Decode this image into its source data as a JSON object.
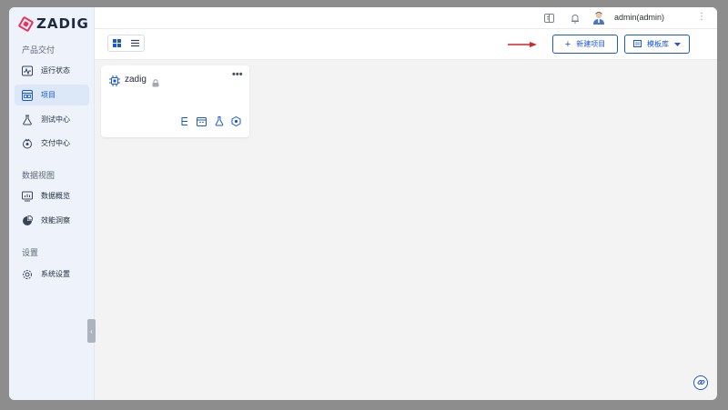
{
  "app": {
    "logo_text": "ZADIG",
    "brand_color": "#e8345a",
    "accent_color": "#1b57d6"
  },
  "sidebar": {
    "sections": [
      {
        "title": "产品交付",
        "items": [
          {
            "label": "运行状态",
            "icon": "pulse-icon",
            "active": false
          },
          {
            "label": "项目",
            "icon": "project-icon",
            "active": true
          },
          {
            "label": "测试中心",
            "icon": "flask-icon",
            "active": false
          },
          {
            "label": "交付中心",
            "icon": "delivery-icon",
            "active": false
          }
        ]
      },
      {
        "title": "数据视图",
        "items": [
          {
            "label": "数据概览",
            "icon": "dashboard-icon",
            "active": false
          },
          {
            "label": "效能洞察",
            "icon": "pie-chart-icon",
            "active": false
          }
        ]
      },
      {
        "title": "设置",
        "items": [
          {
            "label": "系统设置",
            "icon": "gear-icon",
            "active": false
          }
        ]
      }
    ],
    "collapse_glyph": "‹"
  },
  "topbar": {
    "username": "admin(admin)"
  },
  "toolbar": {
    "new_project_label": "新建项目",
    "template_lib_label": "模板库"
  },
  "projects": [
    {
      "name": "zadig",
      "private": true,
      "more_glyph": "•••"
    }
  ]
}
